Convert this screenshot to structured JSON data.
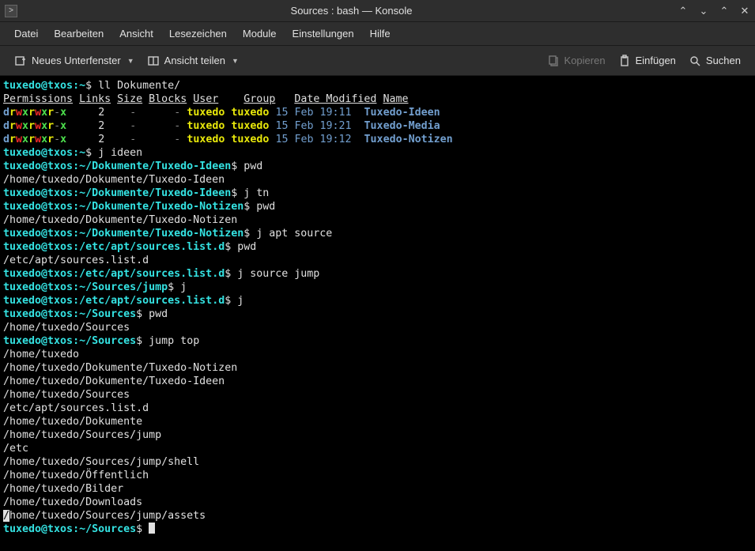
{
  "window": {
    "title": "Sources : bash — Konsole"
  },
  "menubar": [
    "Datei",
    "Bearbeiten",
    "Ansicht",
    "Lesezeichen",
    "Module",
    "Einstellungen",
    "Hilfe"
  ],
  "toolbar": {
    "new_tab": "Neues Unterfenster",
    "split_view": "Ansicht teilen",
    "copy": "Kopieren",
    "paste": "Einfügen",
    "search": "Suchen"
  },
  "prompt": {
    "userhost": "tuxedo@txos",
    "home": "~"
  },
  "ls": {
    "cmd": "ll Dokumente/",
    "headers": [
      "Permissions",
      "Links",
      "Size",
      "Blocks",
      "User",
      "Group",
      "Date Modified",
      "Name"
    ],
    "rows": [
      {
        "perm": "drwxrwxr-x",
        "links": "2",
        "size": "-",
        "blocks": "-",
        "user": "tuxedo",
        "group": "tuxedo",
        "date": "15 Feb 19:11",
        "name": "Tuxedo-Ideen"
      },
      {
        "perm": "drwxrwxr-x",
        "links": "2",
        "size": "-",
        "blocks": "-",
        "user": "tuxedo",
        "group": "tuxedo",
        "date": "15 Feb 19:21",
        "name": "Tuxedo-Media"
      },
      {
        "perm": "drwxrwxr-x",
        "links": "2",
        "size": "-",
        "blocks": "-",
        "user": "tuxedo",
        "group": "tuxedo",
        "date": "15 Feb 19:12",
        "name": "Tuxedo-Notizen"
      }
    ]
  },
  "lines": {
    "l1_cmd": "j ideen",
    "p_ideen": "~/Dokumente/Tuxedo-Ideen",
    "pwd": "pwd",
    "out_ideen": "/home/tuxedo/Dokumente/Tuxedo-Ideen",
    "l2_cmd": "j tn",
    "p_notizen": "~/Dokumente/Tuxedo-Notizen",
    "out_notizen": "/home/tuxedo/Dokumente/Tuxedo-Notizen",
    "l3_cmd": "j apt source",
    "p_apt": "/etc/apt/sources.list.d",
    "out_apt": "/etc/apt/sources.list.d",
    "l4_cmd": "j source jump",
    "p_jump": "~/Sources/jump",
    "l5_cmd": "j",
    "l6_cmd": "j",
    "p_sources": "~/Sources",
    "out_sources": "/home/tuxedo/Sources",
    "l7_cmd": "jump top",
    "top": [
      "/home/tuxedo",
      "/home/tuxedo/Dokumente/Tuxedo-Notizen",
      "/home/tuxedo/Dokumente/Tuxedo-Ideen",
      "/home/tuxedo/Sources",
      "/etc/apt/sources.list.d",
      "/home/tuxedo/Dokumente",
      "/home/tuxedo/Sources/jump",
      "/etc",
      "/home/tuxedo/Sources/jump/shell",
      "/home/tuxedo/Öffentlich",
      "/home/tuxedo/Bilder",
      "/home/tuxedo/Downloads",
      "/home/tuxedo/Sources/jump/assets"
    ]
  }
}
